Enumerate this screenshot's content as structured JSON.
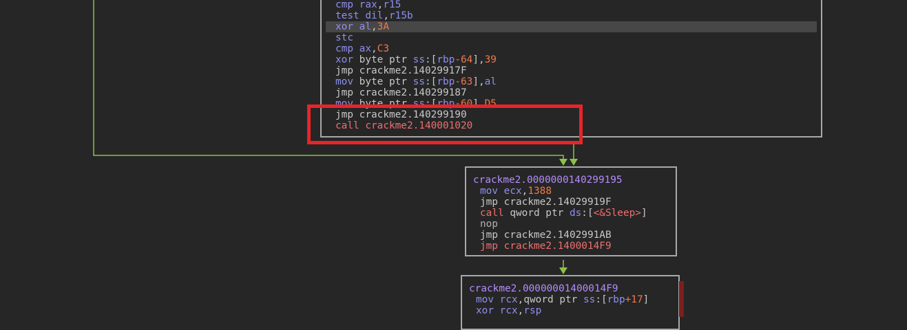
{
  "colors": {
    "background": "#262626",
    "block_border": "#a9a9a9",
    "edge_green": "#8dc14a",
    "highlight_red": "#e8242a",
    "selected_line": "#474747"
  },
  "block_top": {
    "lines": [
      {
        "mnemonic": "cmp",
        "tokens": [
          [
            "reg",
            "rax"
          ],
          [
            "txt",
            ","
          ],
          [
            "reg",
            "r15"
          ]
        ]
      },
      {
        "mnemonic": "test",
        "tokens": [
          [
            "reg",
            "dil"
          ],
          [
            "txt",
            ","
          ],
          [
            "reg",
            "r15b"
          ]
        ]
      },
      {
        "mnemonic": "xor",
        "selected": true,
        "tokens": [
          [
            "reg",
            "al"
          ],
          [
            "txt",
            ","
          ],
          [
            "num",
            "3A"
          ]
        ]
      },
      {
        "mnemonic": "stc",
        "tokens": []
      },
      {
        "mnemonic": "cmp",
        "tokens": [
          [
            "reg",
            "ax"
          ],
          [
            "txt",
            ","
          ],
          [
            "num",
            "C3"
          ]
        ]
      },
      {
        "mnemonic": "xor",
        "tokens": [
          [
            "txt",
            "byte ptr "
          ],
          [
            "reg",
            "ss"
          ],
          [
            "txt",
            ":["
          ],
          [
            "reg",
            "rbp"
          ],
          [
            "num",
            "-64"
          ],
          [
            "txt",
            "],"
          ],
          [
            "num",
            "39"
          ]
        ]
      },
      {
        "mnemonic": "jmp",
        "kind": "jmp",
        "tokens": [
          [
            "txt",
            "crackme2.14029917F"
          ]
        ]
      },
      {
        "mnemonic": "mov",
        "tokens": [
          [
            "txt",
            "byte ptr "
          ],
          [
            "reg",
            "ss"
          ],
          [
            "txt",
            ":["
          ],
          [
            "reg",
            "rbp"
          ],
          [
            "num",
            "-63"
          ],
          [
            "txt",
            "],"
          ],
          [
            "reg",
            "al"
          ]
        ]
      },
      {
        "mnemonic": "jmp",
        "kind": "jmp",
        "tokens": [
          [
            "txt",
            "crackme2.140299187"
          ]
        ]
      },
      {
        "mnemonic": "mov",
        "tokens": [
          [
            "txt",
            "byte ptr "
          ],
          [
            "reg",
            "ss"
          ],
          [
            "txt",
            ":["
          ],
          [
            "reg",
            "rbp"
          ],
          [
            "num",
            "-60"
          ],
          [
            "txt",
            "],"
          ],
          [
            "num",
            "D5"
          ]
        ]
      },
      {
        "mnemonic": "jmp",
        "kind": "jmp",
        "tokens": [
          [
            "txt",
            "crackme2.140299190"
          ]
        ]
      },
      {
        "mnemonic": "call",
        "kind": "call",
        "tokens": [
          [
            "red",
            "crackme2.140001020"
          ]
        ]
      }
    ]
  },
  "block_mid": {
    "label": "crackme2.0000000140299195",
    "lines": [
      {
        "mnemonic": "mov",
        "tokens": [
          [
            "reg",
            "ecx"
          ],
          [
            "txt",
            ","
          ],
          [
            "num",
            "1388"
          ]
        ]
      },
      {
        "mnemonic": "jmp",
        "kind": "jmp",
        "tokens": [
          [
            "txt",
            "crackme2.14029919F"
          ]
        ]
      },
      {
        "mnemonic": "call",
        "kind": "call",
        "tokens": [
          [
            "txt",
            "qword ptr "
          ],
          [
            "reg",
            "ds"
          ],
          [
            "txt",
            ":["
          ],
          [
            "red",
            "<&Sleep>"
          ],
          [
            "txt",
            "]"
          ]
        ]
      },
      {
        "mnemonic": "nop",
        "kind": "nop",
        "tokens": []
      },
      {
        "mnemonic": "jmp",
        "kind": "jmp",
        "tokens": [
          [
            "txt",
            "crackme2.1402991AB"
          ]
        ]
      },
      {
        "mnemonic": "jmp",
        "kind": "call",
        "tokens": [
          [
            "red",
            "crackme2.1400014F9"
          ]
        ]
      }
    ]
  },
  "block_bot": {
    "label": "crackme2.00000001400014F9",
    "lines": [
      {
        "mnemonic": "mov",
        "tokens": [
          [
            "reg",
            "rcx"
          ],
          [
            "txt",
            ",qword ptr "
          ],
          [
            "reg",
            "ss"
          ],
          [
            "txt",
            ":["
          ],
          [
            "reg",
            "rbp"
          ],
          [
            "num",
            "+17"
          ],
          [
            "txt",
            "]"
          ]
        ]
      },
      {
        "mnemonic": "xor",
        "tokens": [
          [
            "reg",
            "rcx"
          ],
          [
            "txt",
            ","
          ],
          [
            "reg",
            "rsp"
          ]
        ]
      }
    ]
  }
}
